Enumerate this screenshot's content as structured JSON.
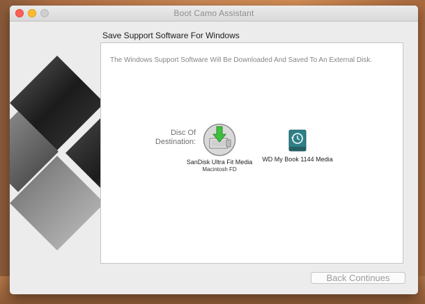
{
  "window": {
    "title": "Boot Camo Assistant"
  },
  "page": {
    "heading": "Save Support Software For Windows",
    "description": "The Windows Support Software Will Be Downloaded And Saved To An External Disk.",
    "destination_label": "Disc Of Destination:"
  },
  "disks": [
    {
      "name": "SanDisk Ultra Fit Media",
      "format": "Macintosh FD",
      "icon": "usb-drive-download-icon",
      "selected": true
    },
    {
      "name": "WD My Book 1144 Media",
      "icon": "time-machine-drive-icon",
      "selected": false
    }
  ],
  "footer": {
    "continue_label": "Back Continues"
  },
  "colors": {
    "close": "#fd5f57",
    "minimize": "#fdbc2e",
    "download_arrow": "#3fbf3f",
    "drive_teal": "#2e7f86"
  }
}
